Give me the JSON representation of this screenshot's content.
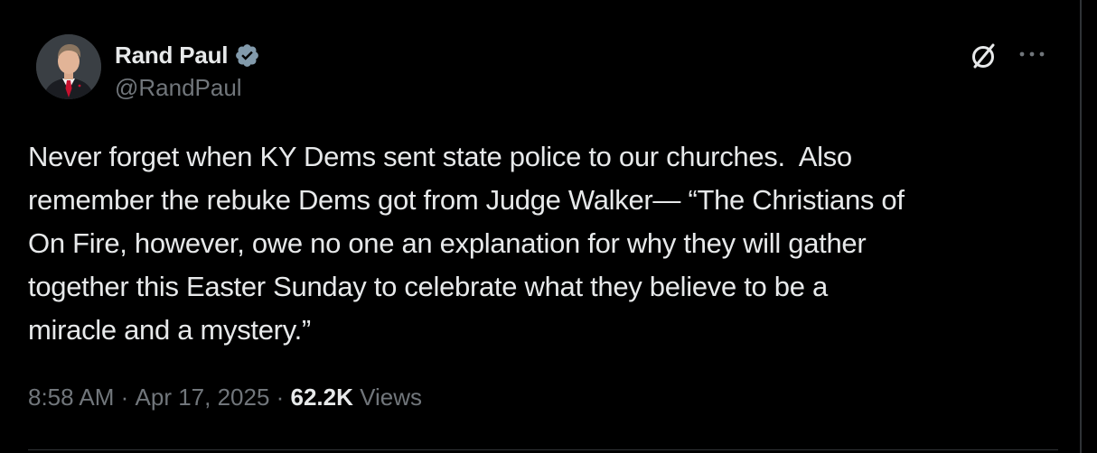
{
  "author": {
    "display_name": "Rand Paul",
    "handle": "@RandPaul",
    "verified": true
  },
  "tweet": {
    "text": "Never forget when KY Dems sent state police to our churches.  Also\nremember the rebuke Dems got from Judge Walker— “The Christians of\nOn Fire, however, owe no one an explanation for why they will gather\ntogether this Easter Sunday to celebrate what they believe to be a\nmiracle and a mystery.”"
  },
  "meta": {
    "time": "8:58 AM",
    "separator": " · ",
    "date": "Apr 17, 2025",
    "views_count": "62.2K",
    "views_label": " Views"
  },
  "icons": {
    "grok": "grok-icon",
    "more": "more-icon",
    "verified": "verified-badge-icon"
  },
  "colors": {
    "background": "#000000",
    "primary_text": "#e7e9ea",
    "secondary_text": "#71767b",
    "verified_badge": "#829aab",
    "divider": "#2f3336"
  }
}
